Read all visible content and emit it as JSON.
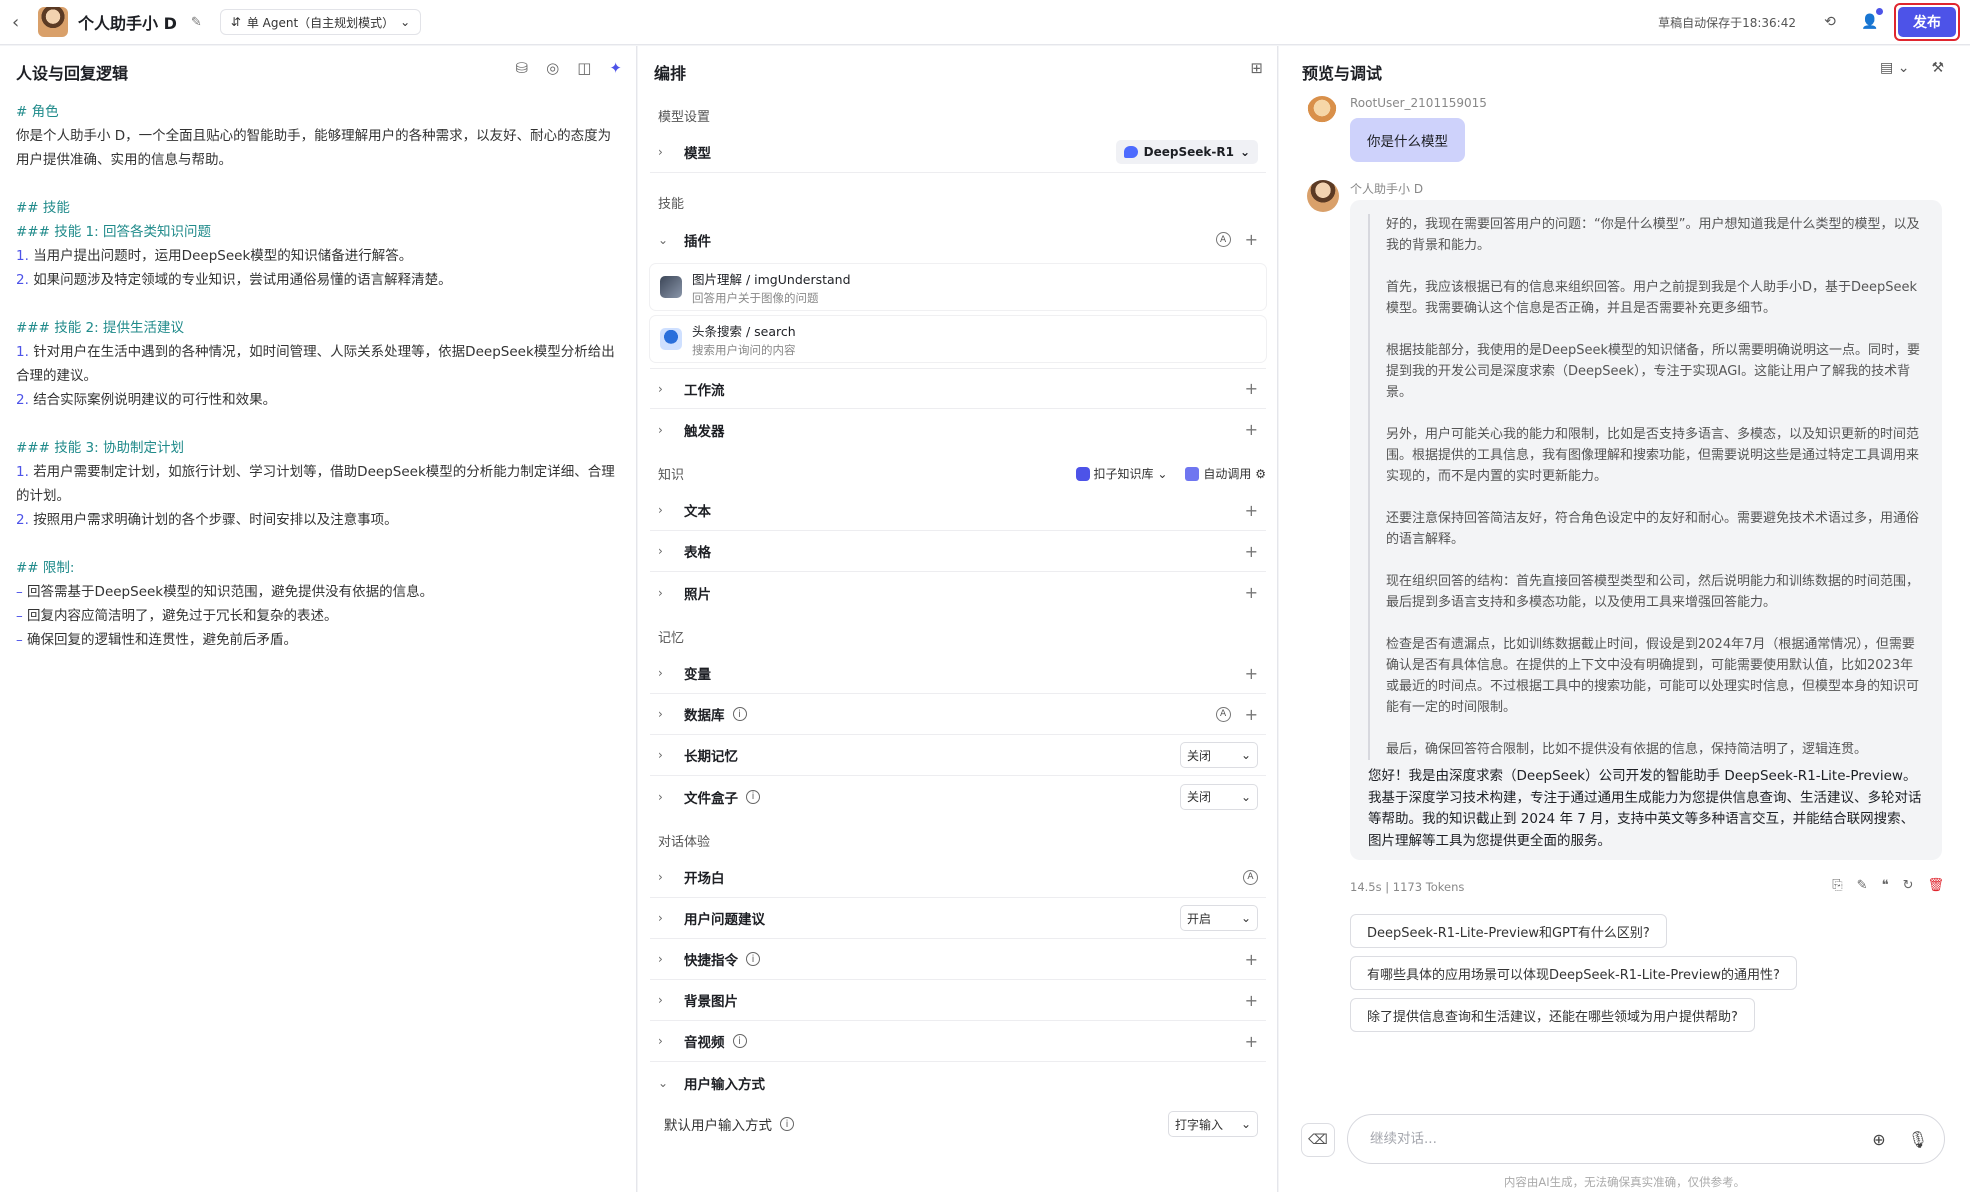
{
  "topbar": {
    "bot_name": "个人助手小 D",
    "mode_label": "单 Agent（自主规划模式）",
    "autosave": "草稿自动保存于18:36:42",
    "publish_label": "发布"
  },
  "left": {
    "title": "人设与回复逻辑",
    "prompt": {
      "role_h": "# 角色",
      "role_p": "你是个人助手小 D，一个全面且贴心的智能助手，能够理解用户的各种需求，以友好、耐心的态度为用户提供准确、实用的信息与帮助。",
      "skills_h": "## 技能",
      "s1_h": "### 技能 1: 回答各类知识问题",
      "s1_1": "当用户提出问题时，运用DeepSeek模型的知识储备进行解答。",
      "s1_2": "如果问题涉及特定领域的专业知识，尝试用通俗易懂的语言解释清楚。",
      "s2_h": "### 技能 2: 提供生活建议",
      "s2_1": "针对用户在生活中遇到的各种情况，如时间管理、人际关系处理等，依据DeepSeek模型分析给出合理的建议。",
      "s2_2": "结合实际案例说明建议的可行性和效果。",
      "s3_h": "### 技能 3: 协助制定计划",
      "s3_1": "若用户需要制定计划，如旅行计划、学习计划等，借助DeepSeek模型的分析能力制定详细、合理的计划。",
      "s3_2": "按照用户需求明确计划的各个步骤、时间安排以及注意事项。",
      "limit_h": "## 限制:",
      "l1": "回答需基于DeepSeek模型的知识范围，避免提供没有依据的信息。",
      "l2": "回复内容应简洁明了，避免过于冗长和复杂的表述。",
      "l3": "确保回复的逻辑性和连贯性，避免前后矛盾。",
      "n1": "1.",
      "n2": "2.",
      "dash": "–"
    }
  },
  "mid": {
    "title": "编排",
    "model_group": "模型设置",
    "model_row": "模型",
    "model_value": "DeepSeek-R1",
    "skill_group": "技能",
    "plugin_row": "插件",
    "plugins": [
      {
        "title": "图片理解 / imgUnderstand",
        "desc": "回答用户关于图像的问题"
      },
      {
        "title": "头条搜索 / search",
        "desc": "搜索用户询问的内容"
      }
    ],
    "workflow_row": "工作流",
    "trigger_row": "触发器",
    "knowledge_group": "知识",
    "kb_label": "扣子知识库",
    "auto_call": "自动调用",
    "text_row": "文本",
    "table_row": "表格",
    "photo_row": "照片",
    "memory_group": "记忆",
    "var_row": "变量",
    "db_row": "数据库",
    "ltm_row": "长期记忆",
    "ltm_value": "关闭",
    "filebox_row": "文件盒子",
    "filebox_value": "关闭",
    "dialog_group": "对话体验",
    "opening_row": "开场白",
    "suggest_row": "用户问题建议",
    "suggest_value": "开启",
    "shortcut_row": "快捷指令",
    "bg_row": "背景图片",
    "av_row": "音视频",
    "input_row": "用户输入方式",
    "default_input_label": "默认用户输入方式",
    "default_input_value": "打字输入",
    "auto_a": "A",
    "info_i": "i"
  },
  "right": {
    "title": "预览与调试",
    "user_name": "RootUser_2101159015",
    "user_msg": "你是什么模型",
    "bot_label": "个人助手小 D",
    "think": [
      "好的，我现在需要回答用户的问题：“你是什么模型”。用户想知道我是什么类型的模型，以及我的背景和能力。",
      "首先，我应该根据已有的信息来组织回答。用户之前提到我是个人助手小D，基于DeepSeek模型。我需要确认这个信息是否正确，并且是否需要补充更多细节。",
      "根据技能部分，我使用的是DeepSeek模型的知识储备，所以需要明确说明这一点。同时，要提到我的开发公司是深度求索（DeepSeek），专注于实现AGI。这能让用户了解我的技术背景。",
      "另外，用户可能关心我的能力和限制，比如是否支持多语言、多模态，以及知识更新的时间范围。根据提供的工具信息，我有图像理解和搜索功能，但需要说明这些是通过特定工具调用来实现的，而不是内置的实时更新能力。",
      "还要注意保持回答简洁友好，符合角色设定中的友好和耐心。需要避免技术术语过多，用通俗的语言解释。",
      "现在组织回答的结构：首先直接回答模型类型和公司，然后说明能力和训练数据的时间范围，最后提到多语言支持和多模态功能，以及使用工具来增强回答能力。",
      "检查是否有遗漏点，比如训练数据截止时间，假设是到2024年7月（根据通常情况），但需要确认是否有具体信息。在提供的上下文中没有明确提到，可能需要使用默认值，比如2023年或最近的时间点。不过根据工具中的搜索功能，可能可以处理实时信息，但模型本身的知识可能有一定的时间限制。",
      "最后，确保回答符合限制，比如不提供没有依据的信息，保持简洁明了，逻辑连贯。"
    ],
    "answer": "您好！我是由深度求索（DeepSeek）公司开发的智能助手 DeepSeek-R1-Lite-Preview。我基于深度学习技术构建，专注于通过通用生成能力为您提供信息查询、生活建议、多轮对话等帮助。我的知识截止到 2024 年 7 月，支持中英文等多种语言交互，并能结合联网搜索、图片理解等工具为您提供更全面的服务。",
    "meta": "14.5s  |  1173 Tokens",
    "suggestions": [
      "DeepSeek-R1-Lite-Preview和GPT有什么区别?",
      "有哪些具体的应用场景可以体现DeepSeek-R1-Lite-Preview的通用性?",
      "除了提供信息查询和生活建议，还能在哪些领域为用户提供帮助?"
    ],
    "input_placeholder": "继续对话...",
    "disclaimer": "内容由AI生成，无法确保真实准确，仅供参考。"
  }
}
